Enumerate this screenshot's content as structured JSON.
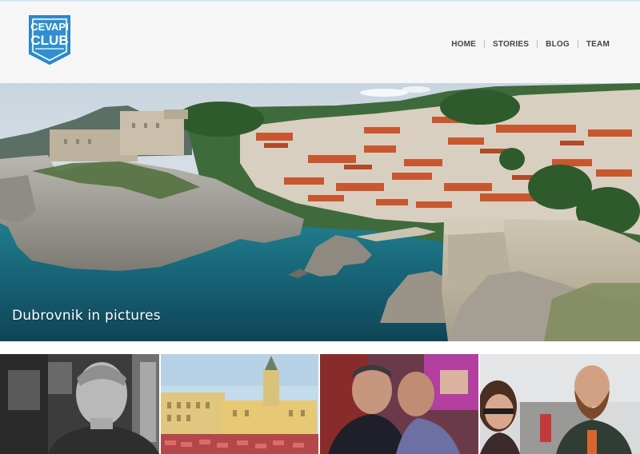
{
  "brand": {
    "logo_line1": "CEVAPI",
    "logo_line2": "CLUB",
    "colors": {
      "logo_blue": "#2f8fd0",
      "logo_border": "#2a84c3"
    }
  },
  "nav": {
    "items": [
      {
        "label": "HOME"
      },
      {
        "label": "STORIES"
      },
      {
        "label": "BLOG"
      },
      {
        "label": "TEAM"
      }
    ]
  },
  "hero": {
    "caption": "Dubrovnik in pictures",
    "image": "dubrovnik-coast-photo"
  },
  "thumbnails": [
    {
      "image": "portrait-grey-haired-man-photo"
    },
    {
      "image": "yellow-city-square-cathedral-photo"
    },
    {
      "image": "two-men-selfie-photo"
    },
    {
      "image": "woman-and-bearded-man-photo"
    }
  ]
}
